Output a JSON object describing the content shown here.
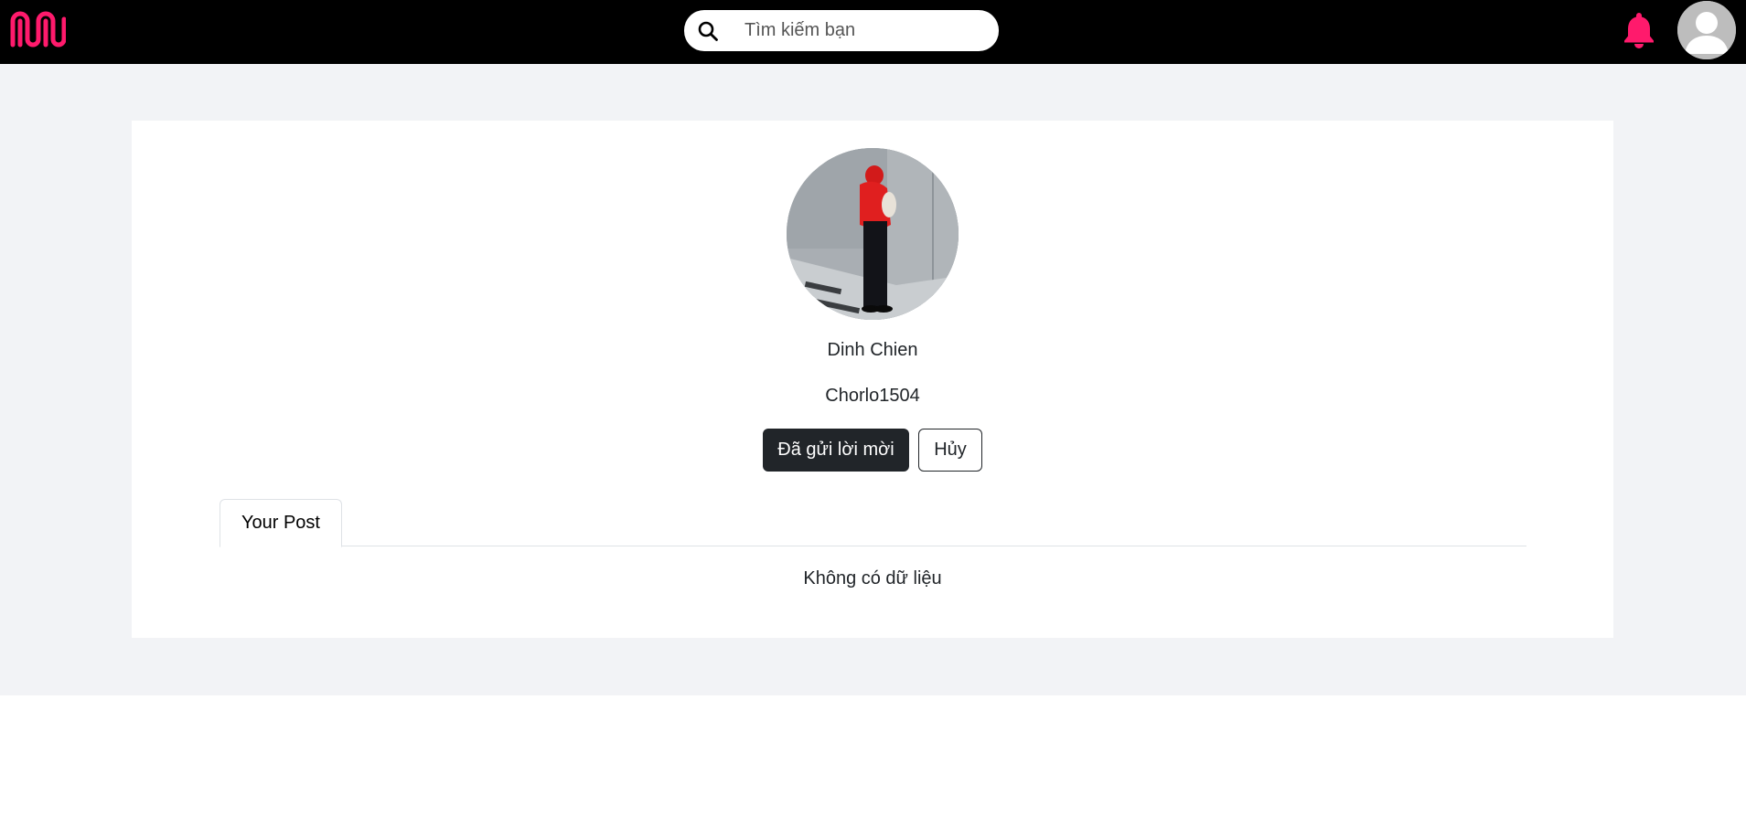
{
  "header": {
    "logo_icon": "brand-wave-logo-icon",
    "search": {
      "icon": "search-icon",
      "placeholder": "Tìm kiếm bạn",
      "value": ""
    },
    "notifications_icon": "bell-icon",
    "avatar_icon": "default-user-avatar-icon"
  },
  "profile": {
    "display_name": "Dinh Chien",
    "username": "Chorlo1504",
    "actions": {
      "sent_request_label": "Đã gửi lời mời",
      "cancel_label": "Hủy"
    }
  },
  "tabs": [
    {
      "label": "Your Post",
      "active": true
    }
  ],
  "posts": {
    "empty_message": "Không có dữ liệu"
  },
  "colors": {
    "topbar": "#000000",
    "accent": "#ff1a6c",
    "page_bg": "#f2f3f6",
    "card_bg": "#ffffff",
    "primary_button": "#212529"
  }
}
